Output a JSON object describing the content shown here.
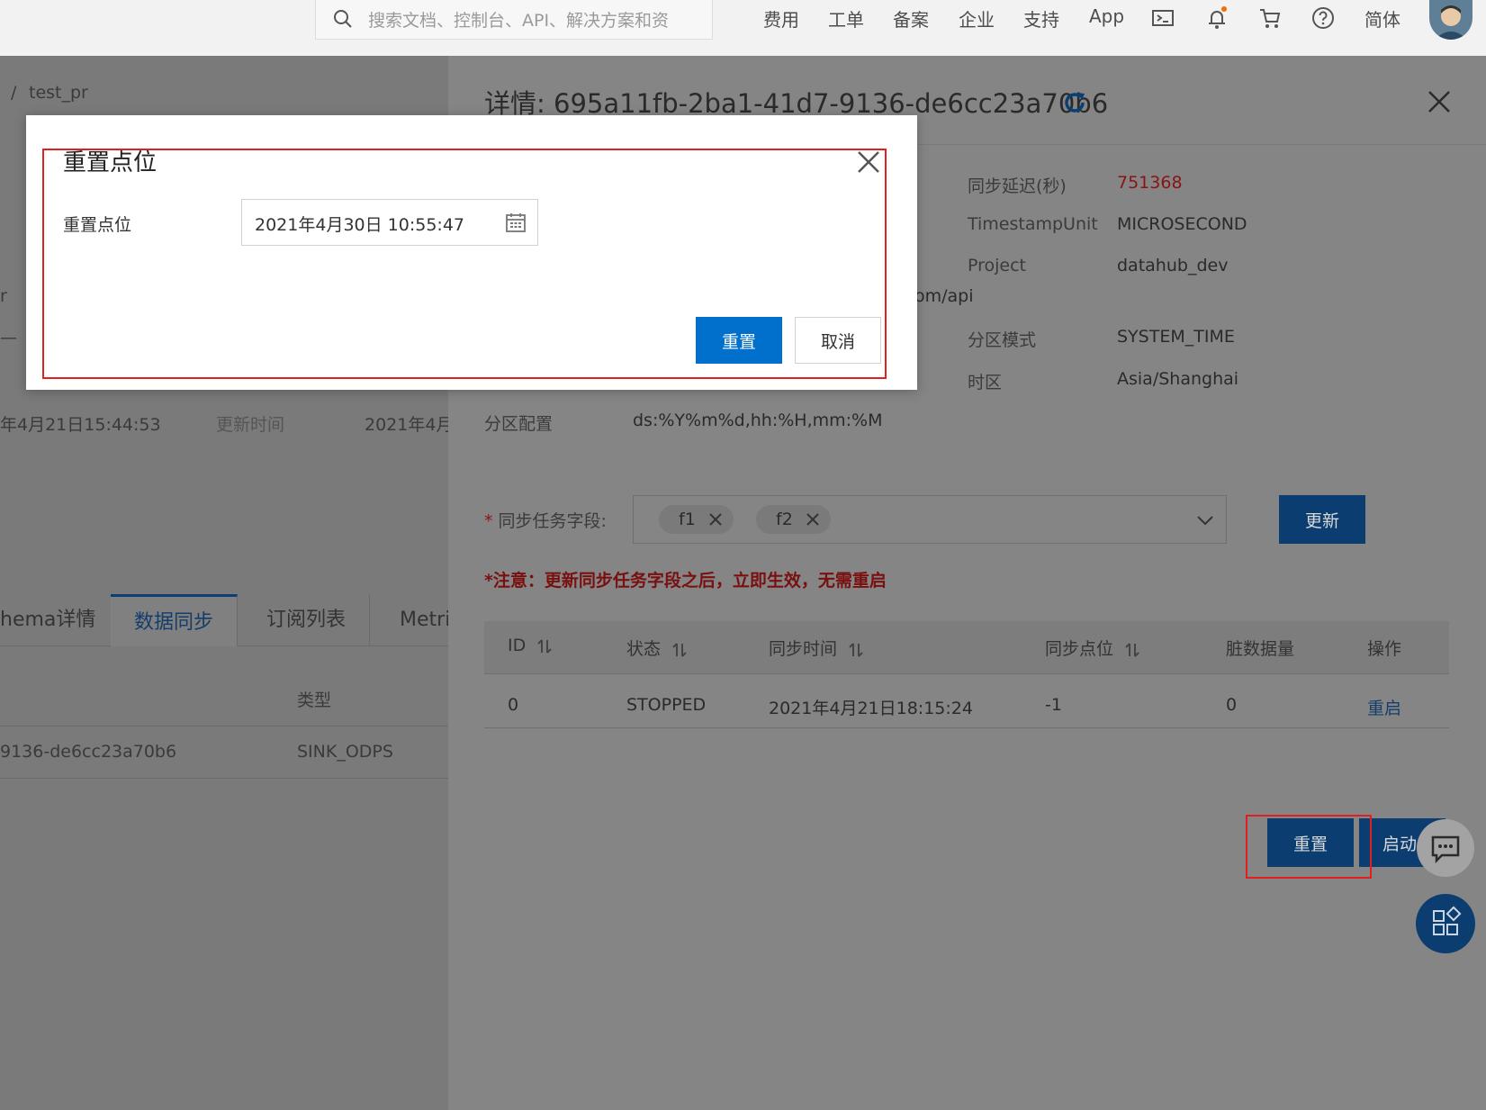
{
  "topbar": {
    "search_placeholder": "搜索文档、控制台、API、解决方案和资",
    "links": [
      "费用",
      "工单",
      "备案",
      "企业",
      "支持",
      "App"
    ],
    "lang_label": "简体"
  },
  "background": {
    "breadcrumb_sep": "/",
    "breadcrumb_item": "test_pr",
    "left_frag_1": "r",
    "left_frag_2": "—",
    "created_time_frag": "年4月21日15:44:53",
    "update_time_label": "更新时间",
    "update_time_frag": "2021年4月",
    "tabs": [
      "hema详情",
      "数据同步",
      "订阅列表",
      "Metri"
    ],
    "active_tab_index": 1,
    "col_type_label": "类型",
    "row_id_frag": "9136-de6cc23a70b6",
    "row_type": "SINK_ODPS"
  },
  "drawer": {
    "title": "详情: 695a11fb-2ba1-41d7-9136-de6cc23a70b6",
    "endpoint_frag": "om/api",
    "fields": [
      {
        "label": "同步延迟(秒)",
        "value": "751368"
      },
      {
        "label": "TimestampUnit",
        "value": "MICROSECOND"
      },
      {
        "label": "Project",
        "value": "datahub_dev"
      },
      {
        "label": "分区模式",
        "value": "SYSTEM_TIME"
      },
      {
        "label": "时区",
        "value": "Asia/Shanghai"
      },
      {
        "label": "分区配置",
        "value": "ds:%Y%m%d,hh:%H,mm:%M"
      }
    ],
    "sync_fields_label": "同步任务字段:",
    "required_mark": "*",
    "tags": [
      "f1",
      "f2"
    ],
    "update_button": "更新",
    "warning": "*注意：更新同步任务字段之后，立即生效，无需重启",
    "table": {
      "headers": [
        "ID",
        "状态",
        "同步时间",
        "同步点位",
        "脏数据量",
        "操作"
      ],
      "rows": [
        {
          "id": "0",
          "status": "STOPPED",
          "sync_time": "2021年4月21日18:15:24",
          "offset": "-1",
          "dirty": "0",
          "action": "重启"
        }
      ]
    },
    "reset_button": "重置",
    "start_button": "启动"
  },
  "modal": {
    "title": "重置点位",
    "field_label": "重置点位",
    "date_value": "2021年4月30日 10:55:47",
    "confirm_button": "重置",
    "cancel_button": "取消"
  },
  "colors": {
    "primary": "#0070cc",
    "highlight_frame": "#e02020",
    "warning": "#7a0f0f",
    "overlay_dim": "#858585"
  }
}
